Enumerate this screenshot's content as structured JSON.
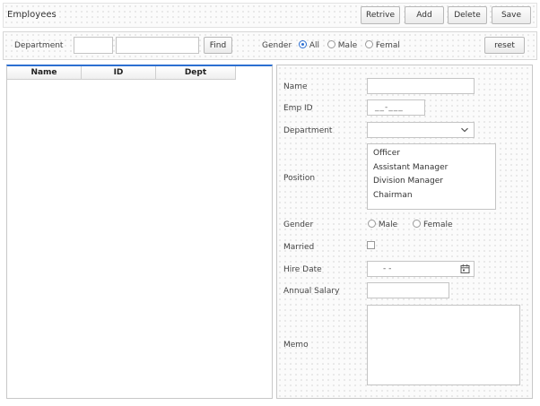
{
  "title": "Employees",
  "toolbar": {
    "retrieve": "Retrive",
    "add": "Add",
    "delete": "Delete",
    "save": "Save"
  },
  "search": {
    "department_label": "Department",
    "dept_code_value": "",
    "dept_name_value": "",
    "find_label": "Find",
    "gender_label": "Gender",
    "gender_options": [
      "All",
      "Male",
      "Femal"
    ],
    "gender_selected": "All",
    "reset_label": "reset"
  },
  "grid": {
    "columns": [
      "Name",
      "ID",
      "Dept"
    ],
    "rows": []
  },
  "form": {
    "name_label": "Name",
    "name_value": "",
    "emp_id_label": "Emp ID",
    "emp_id_mask": "__-___",
    "department_label": "Department",
    "department_value": "",
    "position_label": "Position",
    "position_options": [
      "Officer",
      "Assistant Manager",
      "Division Manager",
      "Chairman"
    ],
    "gender_label": "Gender",
    "gender_options": [
      "Male",
      "Female"
    ],
    "married_label": "Married",
    "married_checked": false,
    "hire_date_label": "Hire Date",
    "hire_date_value": "- -",
    "annual_salary_label": "Annual Salary",
    "annual_salary_value": "",
    "memo_label": "Memo",
    "memo_value": ""
  },
  "colors": {
    "accent": "#2c6fd1",
    "border": "#c4c4c4"
  }
}
